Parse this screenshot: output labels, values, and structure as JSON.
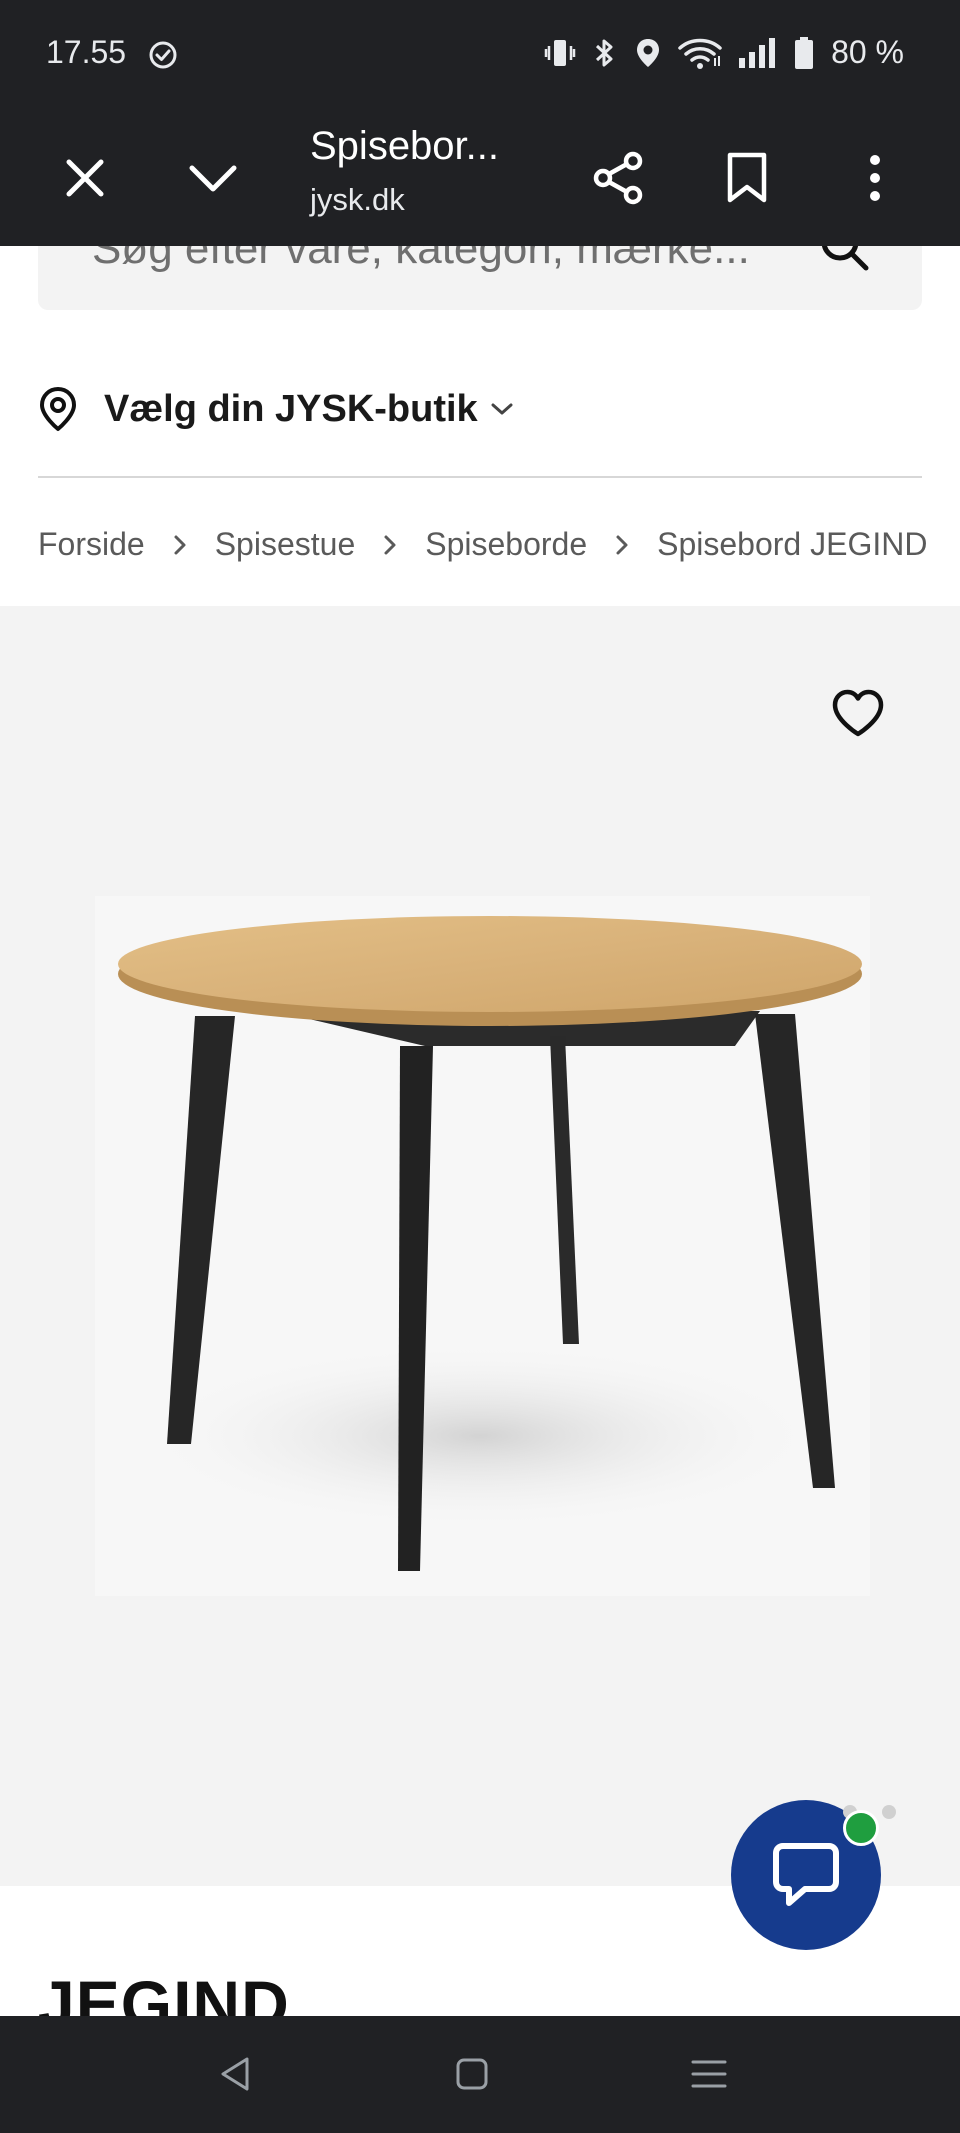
{
  "status_bar": {
    "time": "17.55",
    "battery": "80 %",
    "icons": [
      "check-circle-icon",
      "vibrate-icon",
      "bluetooth-icon",
      "location-icon",
      "wifi-icon",
      "signal-icon",
      "battery-icon"
    ]
  },
  "toolbar": {
    "title": "Spisebor...",
    "url": "jysk.dk",
    "icons": [
      "close-icon",
      "chevron-down-icon",
      "share-icon",
      "bookmark-icon",
      "more-vert-icon"
    ]
  },
  "search": {
    "placeholder": "Søg efter vare, kategori, mærke..."
  },
  "store": {
    "label": "Vælg din JYSK-butik"
  },
  "breadcrumb": {
    "items": [
      "Forside",
      "Spisestue",
      "Spiseborde",
      "Spisebord JEGIND"
    ]
  },
  "product": {
    "name": "JEGIND",
    "image_alt": "round dining table"
  },
  "colors": {
    "system_bar": "#202124",
    "chat_button": "#163b8d",
    "online_dot": "#1f9e3f",
    "image_background": "#f3f3f3"
  }
}
